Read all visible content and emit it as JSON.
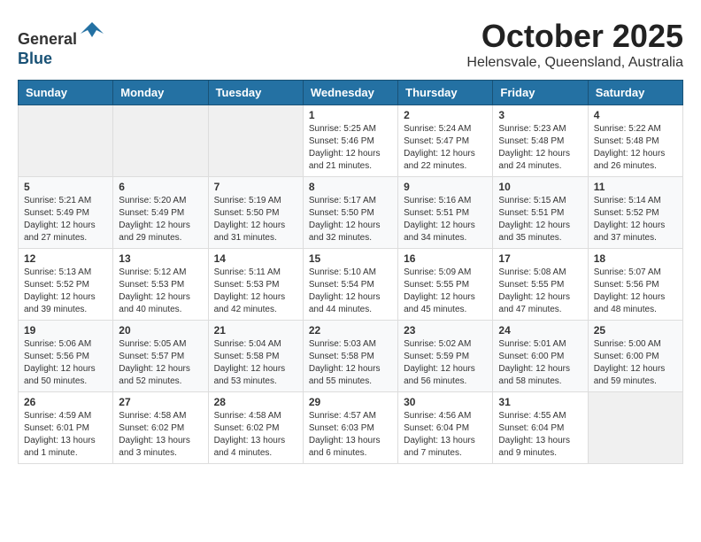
{
  "header": {
    "logo_line1": "General",
    "logo_line2": "Blue",
    "title": "October 2025",
    "subtitle": "Helensvale, Queensland, Australia"
  },
  "weekdays": [
    "Sunday",
    "Monday",
    "Tuesday",
    "Wednesday",
    "Thursday",
    "Friday",
    "Saturday"
  ],
  "weeks": [
    [
      {
        "day": "",
        "sunrise": "",
        "sunset": "",
        "daylight": ""
      },
      {
        "day": "",
        "sunrise": "",
        "sunset": "",
        "daylight": ""
      },
      {
        "day": "",
        "sunrise": "",
        "sunset": "",
        "daylight": ""
      },
      {
        "day": "1",
        "sunrise": "Sunrise: 5:25 AM",
        "sunset": "Sunset: 5:46 PM",
        "daylight": "Daylight: 12 hours and 21 minutes."
      },
      {
        "day": "2",
        "sunrise": "Sunrise: 5:24 AM",
        "sunset": "Sunset: 5:47 PM",
        "daylight": "Daylight: 12 hours and 22 minutes."
      },
      {
        "day": "3",
        "sunrise": "Sunrise: 5:23 AM",
        "sunset": "Sunset: 5:48 PM",
        "daylight": "Daylight: 12 hours and 24 minutes."
      },
      {
        "day": "4",
        "sunrise": "Sunrise: 5:22 AM",
        "sunset": "Sunset: 5:48 PM",
        "daylight": "Daylight: 12 hours and 26 minutes."
      }
    ],
    [
      {
        "day": "5",
        "sunrise": "Sunrise: 5:21 AM",
        "sunset": "Sunset: 5:49 PM",
        "daylight": "Daylight: 12 hours and 27 minutes."
      },
      {
        "day": "6",
        "sunrise": "Sunrise: 5:20 AM",
        "sunset": "Sunset: 5:49 PM",
        "daylight": "Daylight: 12 hours and 29 minutes."
      },
      {
        "day": "7",
        "sunrise": "Sunrise: 5:19 AM",
        "sunset": "Sunset: 5:50 PM",
        "daylight": "Daylight: 12 hours and 31 minutes."
      },
      {
        "day": "8",
        "sunrise": "Sunrise: 5:17 AM",
        "sunset": "Sunset: 5:50 PM",
        "daylight": "Daylight: 12 hours and 32 minutes."
      },
      {
        "day": "9",
        "sunrise": "Sunrise: 5:16 AM",
        "sunset": "Sunset: 5:51 PM",
        "daylight": "Daylight: 12 hours and 34 minutes."
      },
      {
        "day": "10",
        "sunrise": "Sunrise: 5:15 AM",
        "sunset": "Sunset: 5:51 PM",
        "daylight": "Daylight: 12 hours and 35 minutes."
      },
      {
        "day": "11",
        "sunrise": "Sunrise: 5:14 AM",
        "sunset": "Sunset: 5:52 PM",
        "daylight": "Daylight: 12 hours and 37 minutes."
      }
    ],
    [
      {
        "day": "12",
        "sunrise": "Sunrise: 5:13 AM",
        "sunset": "Sunset: 5:52 PM",
        "daylight": "Daylight: 12 hours and 39 minutes."
      },
      {
        "day": "13",
        "sunrise": "Sunrise: 5:12 AM",
        "sunset": "Sunset: 5:53 PM",
        "daylight": "Daylight: 12 hours and 40 minutes."
      },
      {
        "day": "14",
        "sunrise": "Sunrise: 5:11 AM",
        "sunset": "Sunset: 5:53 PM",
        "daylight": "Daylight: 12 hours and 42 minutes."
      },
      {
        "day": "15",
        "sunrise": "Sunrise: 5:10 AM",
        "sunset": "Sunset: 5:54 PM",
        "daylight": "Daylight: 12 hours and 44 minutes."
      },
      {
        "day": "16",
        "sunrise": "Sunrise: 5:09 AM",
        "sunset": "Sunset: 5:55 PM",
        "daylight": "Daylight: 12 hours and 45 minutes."
      },
      {
        "day": "17",
        "sunrise": "Sunrise: 5:08 AM",
        "sunset": "Sunset: 5:55 PM",
        "daylight": "Daylight: 12 hours and 47 minutes."
      },
      {
        "day": "18",
        "sunrise": "Sunrise: 5:07 AM",
        "sunset": "Sunset: 5:56 PM",
        "daylight": "Daylight: 12 hours and 48 minutes."
      }
    ],
    [
      {
        "day": "19",
        "sunrise": "Sunrise: 5:06 AM",
        "sunset": "Sunset: 5:56 PM",
        "daylight": "Daylight: 12 hours and 50 minutes."
      },
      {
        "day": "20",
        "sunrise": "Sunrise: 5:05 AM",
        "sunset": "Sunset: 5:57 PM",
        "daylight": "Daylight: 12 hours and 52 minutes."
      },
      {
        "day": "21",
        "sunrise": "Sunrise: 5:04 AM",
        "sunset": "Sunset: 5:58 PM",
        "daylight": "Daylight: 12 hours and 53 minutes."
      },
      {
        "day": "22",
        "sunrise": "Sunrise: 5:03 AM",
        "sunset": "Sunset: 5:58 PM",
        "daylight": "Daylight: 12 hours and 55 minutes."
      },
      {
        "day": "23",
        "sunrise": "Sunrise: 5:02 AM",
        "sunset": "Sunset: 5:59 PM",
        "daylight": "Daylight: 12 hours and 56 minutes."
      },
      {
        "day": "24",
        "sunrise": "Sunrise: 5:01 AM",
        "sunset": "Sunset: 6:00 PM",
        "daylight": "Daylight: 12 hours and 58 minutes."
      },
      {
        "day": "25",
        "sunrise": "Sunrise: 5:00 AM",
        "sunset": "Sunset: 6:00 PM",
        "daylight": "Daylight: 12 hours and 59 minutes."
      }
    ],
    [
      {
        "day": "26",
        "sunrise": "Sunrise: 4:59 AM",
        "sunset": "Sunset: 6:01 PM",
        "daylight": "Daylight: 13 hours and 1 minute."
      },
      {
        "day": "27",
        "sunrise": "Sunrise: 4:58 AM",
        "sunset": "Sunset: 6:02 PM",
        "daylight": "Daylight: 13 hours and 3 minutes."
      },
      {
        "day": "28",
        "sunrise": "Sunrise: 4:58 AM",
        "sunset": "Sunset: 6:02 PM",
        "daylight": "Daylight: 13 hours and 4 minutes."
      },
      {
        "day": "29",
        "sunrise": "Sunrise: 4:57 AM",
        "sunset": "Sunset: 6:03 PM",
        "daylight": "Daylight: 13 hours and 6 minutes."
      },
      {
        "day": "30",
        "sunrise": "Sunrise: 4:56 AM",
        "sunset": "Sunset: 6:04 PM",
        "daylight": "Daylight: 13 hours and 7 minutes."
      },
      {
        "day": "31",
        "sunrise": "Sunrise: 4:55 AM",
        "sunset": "Sunset: 6:04 PM",
        "daylight": "Daylight: 13 hours and 9 minutes."
      },
      {
        "day": "",
        "sunrise": "",
        "sunset": "",
        "daylight": ""
      }
    ]
  ]
}
